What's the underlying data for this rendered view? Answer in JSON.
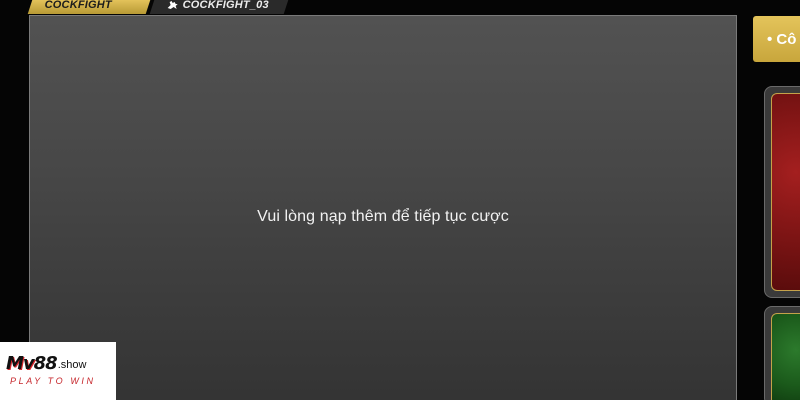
{
  "tabs": [
    {
      "label": "COCKFIGHT",
      "active": true
    },
    {
      "label": "COCKFIGHT_03",
      "active": false,
      "icon": "rooster-icon"
    }
  ],
  "main": {
    "message": "Vui lòng nạp thêm để tiếp tục cược"
  },
  "side_panel": {
    "header_label": "• Cô",
    "cards": [
      {
        "color": "#8f1a1a"
      },
      {
        "color": "#1f6a1f"
      }
    ]
  },
  "watermark": {
    "brand": "Mv",
    "number": "88",
    "domain": ".show",
    "tagline": "PLAY TO WIN"
  },
  "colors": {
    "accent_gold": "#d4b24a",
    "panel_bg": "#474747",
    "background": "#050505"
  }
}
